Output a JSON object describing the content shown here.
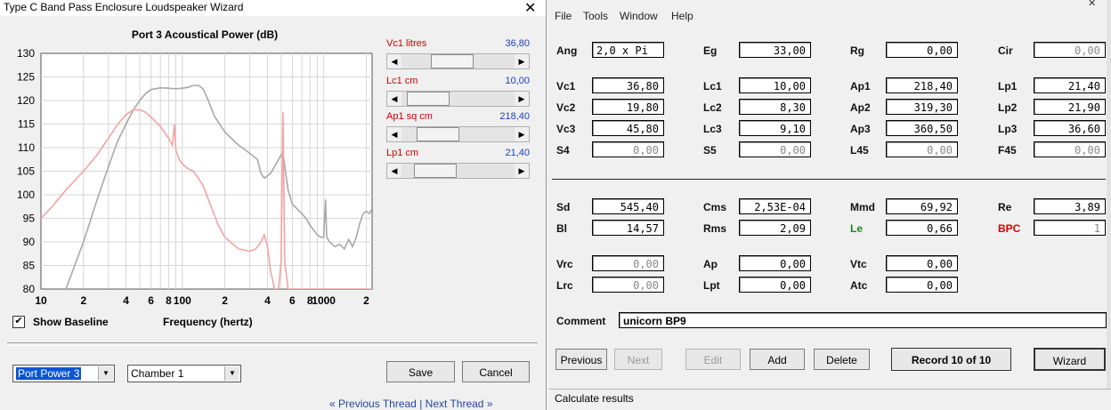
{
  "main": {
    "title": "",
    "menu": [
      "File",
      "Tools",
      "Window",
      "Help"
    ],
    "fields": {
      "ang": {
        "label": "Ang",
        "value": "2,0 x Pi"
      },
      "eg": {
        "label": "Eg",
        "value": "33,00"
      },
      "rg": {
        "label": "Rg",
        "value": "0,00"
      },
      "cir": {
        "label": "Cir",
        "value": "0,00"
      },
      "vc1": {
        "label": "Vc1",
        "value": "36,80"
      },
      "lc1": {
        "label": "Lc1",
        "value": "10,00"
      },
      "ap1": {
        "label": "Ap1",
        "value": "218,40"
      },
      "lp1": {
        "label": "Lp1",
        "value": "21,40"
      },
      "vc2": {
        "label": "Vc2",
        "value": "19,80"
      },
      "lc2": {
        "label": "Lc2",
        "value": "8,30"
      },
      "ap2": {
        "label": "Ap2",
        "value": "319,30"
      },
      "lp2": {
        "label": "Lp2",
        "value": "21,90"
      },
      "vc3": {
        "label": "Vc3",
        "value": "45,80"
      },
      "lc3": {
        "label": "Lc3",
        "value": "9,10"
      },
      "ap3": {
        "label": "Ap3",
        "value": "360,50"
      },
      "lp3": {
        "label": "Lp3",
        "value": "36,60"
      },
      "s4": {
        "label": "S4",
        "value": "0,00"
      },
      "s5": {
        "label": "S5",
        "value": "0,00"
      },
      "l45": {
        "label": "L45",
        "value": "0,00"
      },
      "f45": {
        "label": "F45",
        "value": "0,00"
      },
      "sd": {
        "label": "Sd",
        "value": "545,40"
      },
      "cms": {
        "label": "Cms",
        "value": "2,53E-04"
      },
      "mmd": {
        "label": "Mmd",
        "value": "69,92"
      },
      "re": {
        "label": "Re",
        "value": "3,89"
      },
      "bl": {
        "label": "Bl",
        "value": "14,57"
      },
      "rms": {
        "label": "Rms",
        "value": "2,09"
      },
      "le": {
        "label": "Le",
        "value": "0,66"
      },
      "bpc": {
        "label": "BPC",
        "value": "1"
      },
      "vrc": {
        "label": "Vrc",
        "value": "0,00"
      },
      "ap": {
        "label": "Ap",
        "value": "0,00"
      },
      "vtc": {
        "label": "Vtc",
        "value": "0,00"
      },
      "lrc": {
        "label": "Lrc",
        "value": "0,00"
      },
      "lpt": {
        "label": "Lpt",
        "value": "0,00"
      },
      "atc": {
        "label": "Atc",
        "value": "0,00"
      }
    },
    "comment": {
      "label": "Comment",
      "value": "unicorn BP9"
    },
    "buttons": {
      "previous": "Previous",
      "next": "Next",
      "edit": "Edit",
      "add": "Add",
      "delete": "Delete",
      "record": "Record 10 of 10",
      "wizard": "Wizard"
    },
    "status": "Calculate results"
  },
  "dialog": {
    "title": "Type C Band Pass Enclosure Loudspeaker Wizard",
    "close_glyph": "✕",
    "sliders": [
      {
        "label": "Vc1  litres",
        "value": "36,80",
        "position": 0.42
      },
      {
        "label": "Lc1  cm",
        "value": "10,00",
        "position": 0.08
      },
      {
        "label": "Ap1  sq cm",
        "value": "218,40",
        "position": 0.22
      },
      {
        "label": "Lp1  cm",
        "value": "21,40",
        "position": 0.18
      }
    ],
    "show_baseline": {
      "label": "Show Baseline",
      "checked": true
    },
    "frequency_label": "Frequency (hertz)",
    "combo_output": "Port Power 3",
    "combo_chamber": "Chamber 1",
    "save_label": "Save",
    "cancel_label": "Cancel"
  },
  "thread_nav": {
    "prev_arrows": "«",
    "previous": "Previous Thread",
    "separator": "|",
    "next": "Next Thread",
    "next_arrows": "»"
  },
  "chart_data": {
    "type": "line",
    "title": "Port 3 Acoustical Power (dB)",
    "xlabel": "Frequency (hertz)",
    "ylabel": "",
    "x_scale": "log",
    "xlim": [
      10,
      2200
    ],
    "ylim": [
      80,
      130
    ],
    "yticks": [
      80,
      85,
      90,
      95,
      100,
      105,
      110,
      115,
      120,
      125,
      130
    ],
    "xtick_labels": [
      {
        "x": 10,
        "label": "10"
      },
      {
        "x": 20,
        "label": "2"
      },
      {
        "x": 40,
        "label": "4"
      },
      {
        "x": 60,
        "label": "6"
      },
      {
        "x": 80,
        "label": "8"
      },
      {
        "x": 100,
        "label": "100"
      },
      {
        "x": 200,
        "label": "2"
      },
      {
        "x": 400,
        "label": "4"
      },
      {
        "x": 600,
        "label": "6"
      },
      {
        "x": 800,
        "label": "8"
      },
      {
        "x": 1000,
        "label": "1000"
      },
      {
        "x": 2000,
        "label": "2"
      }
    ],
    "grid": true,
    "series": [
      {
        "color": "#a8a8a8",
        "points": [
          [
            15,
            80
          ],
          [
            20,
            90
          ],
          [
            25,
            99
          ],
          [
            30,
            106
          ],
          [
            35,
            111.5
          ],
          [
            40,
            115
          ],
          [
            45,
            118
          ],
          [
            50,
            120
          ],
          [
            55,
            121.5
          ],
          [
            60,
            122.3
          ],
          [
            70,
            122.7
          ],
          [
            80,
            122.6
          ],
          [
            90,
            122.5
          ],
          [
            100,
            122.6
          ],
          [
            110,
            122.8
          ],
          [
            120,
            123.2
          ],
          [
            130,
            123.2
          ],
          [
            140,
            122.5
          ],
          [
            150,
            120.5
          ],
          [
            170,
            116.5
          ],
          [
            200,
            113.3
          ],
          [
            250,
            110.5
          ],
          [
            300,
            108.8
          ],
          [
            340,
            107.5
          ],
          [
            360,
            104.5
          ],
          [
            380,
            103.5
          ],
          [
            420,
            104.5
          ],
          [
            460,
            106.5
          ],
          [
            500,
            108.5
          ],
          [
            520,
            108
          ],
          [
            560,
            101
          ],
          [
            600,
            98
          ],
          [
            650,
            97
          ],
          [
            700,
            96
          ],
          [
            750,
            95
          ],
          [
            800,
            93.5
          ],
          [
            850,
            92.5
          ],
          [
            900,
            91.5
          ],
          [
            950,
            91
          ],
          [
            1000,
            91
          ],
          [
            1030,
            99
          ],
          [
            1050,
            91
          ],
          [
            1100,
            90
          ],
          [
            1200,
            89
          ],
          [
            1300,
            89.5
          ],
          [
            1400,
            88.5
          ],
          [
            1500,
            90.5
          ],
          [
            1600,
            89
          ],
          [
            1700,
            91
          ],
          [
            1800,
            94
          ],
          [
            1900,
            96
          ],
          [
            2000,
            96.5
          ],
          [
            2100,
            96
          ],
          [
            2200,
            97
          ]
        ]
      },
      {
        "color": "#f4a3a3",
        "points": [
          [
            10,
            95
          ],
          [
            12,
            97.5
          ],
          [
            15,
            101
          ],
          [
            20,
            105
          ],
          [
            25,
            108.5
          ],
          [
            30,
            112
          ],
          [
            35,
            115
          ],
          [
            40,
            117
          ],
          [
            45,
            118
          ],
          [
            50,
            118
          ],
          [
            55,
            117.5
          ],
          [
            60,
            116.5
          ],
          [
            70,
            114.5
          ],
          [
            80,
            112
          ],
          [
            85,
            110.5
          ],
          [
            88,
            115
          ],
          [
            90,
            109.5
          ],
          [
            95,
            107.5
          ],
          [
            100,
            106.5
          ],
          [
            110,
            105.5
          ],
          [
            120,
            105
          ],
          [
            140,
            102
          ],
          [
            160,
            97.5
          ],
          [
            180,
            93.5
          ],
          [
            200,
            91
          ],
          [
            250,
            88.5
          ],
          [
            300,
            88
          ],
          [
            330,
            88.5
          ],
          [
            360,
            90
          ],
          [
            380,
            91.5
          ],
          [
            400,
            89
          ],
          [
            420,
            84
          ],
          [
            450,
            80
          ],
          [
            480,
            80
          ],
          [
            500,
            86
          ],
          [
            515,
            117.5
          ],
          [
            530,
            86
          ],
          [
            560,
            80
          ],
          [
            2200,
            80
          ]
        ]
      }
    ]
  }
}
